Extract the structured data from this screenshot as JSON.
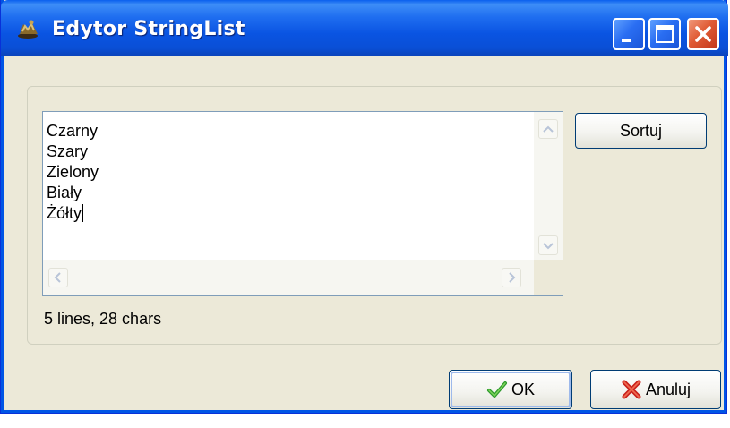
{
  "window": {
    "title": "Edytor StringList",
    "icon": "app-pawn-icon",
    "controls": [
      "minimize-icon",
      "maximize-icon",
      "close-icon"
    ],
    "accent_color": "#0a54e2"
  },
  "memo": {
    "lines": [
      "Czarny",
      "Szary",
      "Zielony",
      "Biały",
      "Żółty"
    ]
  },
  "status": "5 lines, 28 chars",
  "buttons": {
    "sort_label": "Sortuj",
    "ok_label": "OK",
    "cancel_label": "Anuluj"
  },
  "icons": {
    "ok": "checkmark-icon",
    "cancel": "x-icon"
  }
}
